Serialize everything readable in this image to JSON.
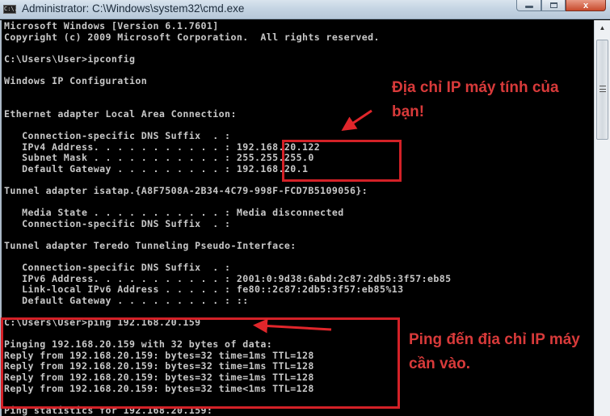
{
  "window": {
    "icon": "cmd-icon",
    "icon_text": "C:\\.",
    "title": "Administrator: C:\\Windows\\system32\\cmd.exe",
    "controls": {
      "minimize": "minimize",
      "maximize": "maximize",
      "close": "x"
    }
  },
  "console": {
    "lines": [
      "Microsoft Windows [Version 6.1.7601]",
      "Copyright (c) 2009 Microsoft Corporation.  All rights reserved.",
      "",
      "C:\\Users\\User>ipconfig",
      "",
      "Windows IP Configuration",
      "",
      "",
      "Ethernet adapter Local Area Connection:",
      "",
      "   Connection-specific DNS Suffix  . :",
      "   IPv4 Address. . . . . . . . . . . : 192.168.20.122",
      "   Subnet Mask . . . . . . . . . . . : 255.255.255.0",
      "   Default Gateway . . . . . . . . . : 192.168.20.1",
      "",
      "Tunnel adapter isatap.{A8F7508A-2B34-4C79-998F-FCD7B5109056}:",
      "",
      "   Media State . . . . . . . . . . . : Media disconnected",
      "   Connection-specific DNS Suffix  . :",
      "",
      "Tunnel adapter Teredo Tunneling Pseudo-Interface:",
      "",
      "   Connection-specific DNS Suffix  . :",
      "   IPv6 Address. . . . . . . . . . . : 2001:0:9d38:6abd:2c87:2db5:3f57:eb85",
      "   Link-local IPv6 Address . . . . . : fe80::2c87:2db5:3f57:eb85%13",
      "   Default Gateway . . . . . . . . . : ::",
      "",
      "C:\\Users\\User>ping 192.168.20.159",
      "",
      "Pinging 192.168.20.159 with 32 bytes of data:",
      "Reply from 192.168.20.159: bytes=32 time=1ms TTL=128",
      "Reply from 192.168.20.159: bytes=32 time=1ms TTL=128",
      "Reply from 192.168.20.159: bytes=32 time=1ms TTL=128",
      "Reply from 192.168.20.159: bytes=32 time<1ms TTL=128",
      "",
      "Ping statistics for 192.168.20.159:"
    ]
  },
  "scrollbar": {
    "up_arrow": "▲"
  },
  "annotations": {
    "ip_note": "Địa chỉ IP máy tính của bạn!",
    "ping_note": "Ping đến địa chỉ IP máy cần vào.",
    "color": "#d32127"
  }
}
